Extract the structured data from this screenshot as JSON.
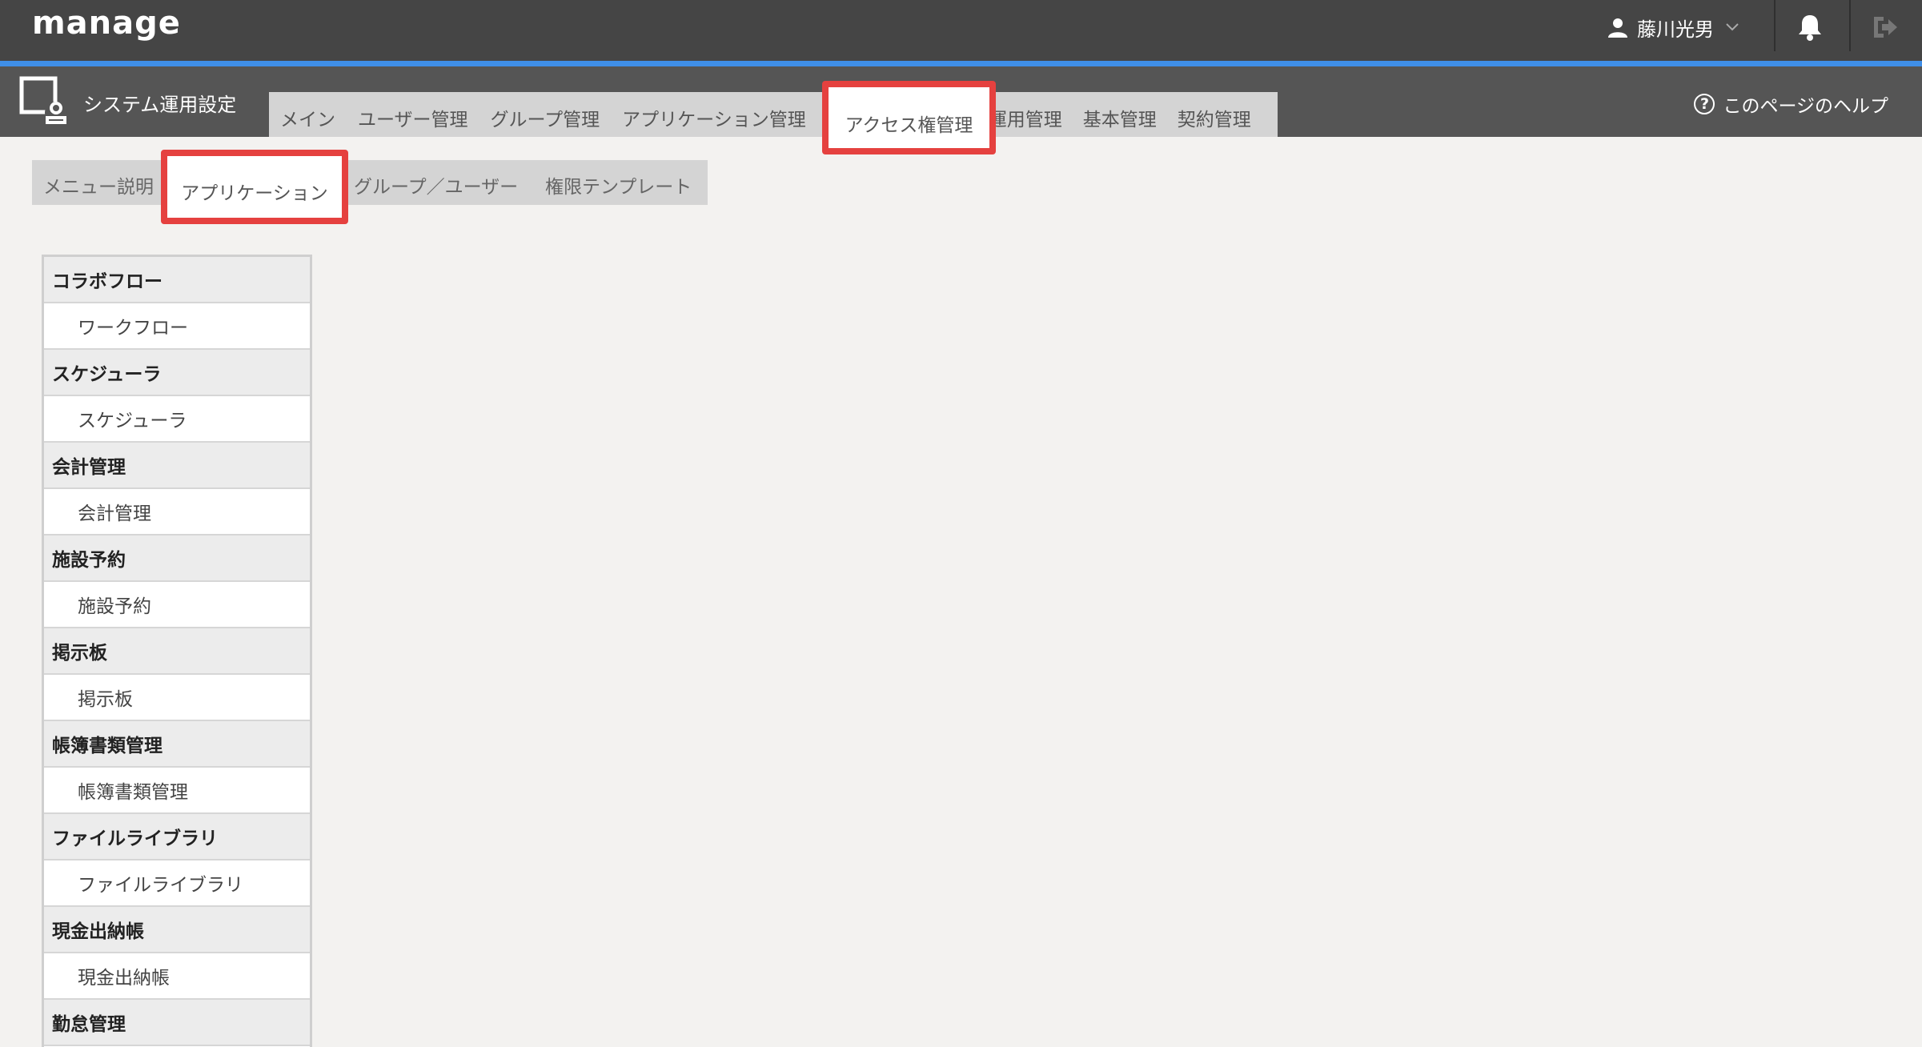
{
  "header": {
    "logo": "manage",
    "user_name": "藤川光男"
  },
  "section": {
    "title": "システム運用設定",
    "help_label": "このページのヘルプ"
  },
  "main_tabs": [
    {
      "label": "メイン"
    },
    {
      "label": "ユーザー管理"
    },
    {
      "label": "グループ管理"
    },
    {
      "label": "アプリケーション管理"
    },
    {
      "label": "アクセス権管理",
      "active": true
    },
    {
      "label": "運用管理"
    },
    {
      "label": "基本管理"
    },
    {
      "label": "契約管理"
    }
  ],
  "sub_tabs": [
    {
      "label": "メニュー説明"
    },
    {
      "label": "アプリケーション",
      "active": true
    },
    {
      "label": "グループ／ユーザー"
    },
    {
      "label": "権限テンプレート"
    }
  ],
  "app_list": [
    {
      "category": "コラボフロー",
      "item": "ワークフロー"
    },
    {
      "category": "スケジューラ",
      "item": "スケジューラ"
    },
    {
      "category": "会計管理",
      "item": "会計管理"
    },
    {
      "category": "施設予約",
      "item": "施設予約"
    },
    {
      "category": "掲示板",
      "item": "掲示板"
    },
    {
      "category": "帳簿書類管理",
      "item": "帳簿書類管理"
    },
    {
      "category": "ファイルライブラリ",
      "item": "ファイルライブラリ"
    },
    {
      "category": "現金出納帳",
      "item": "現金出納帳"
    },
    {
      "category": "勤怠管理"
    }
  ],
  "colors": {
    "header_bg": "#454545",
    "accent_line": "#3f8fe8",
    "secondary_bg": "#555555",
    "tab_bg": "#d4d4d4",
    "highlight": "#e5413f"
  }
}
